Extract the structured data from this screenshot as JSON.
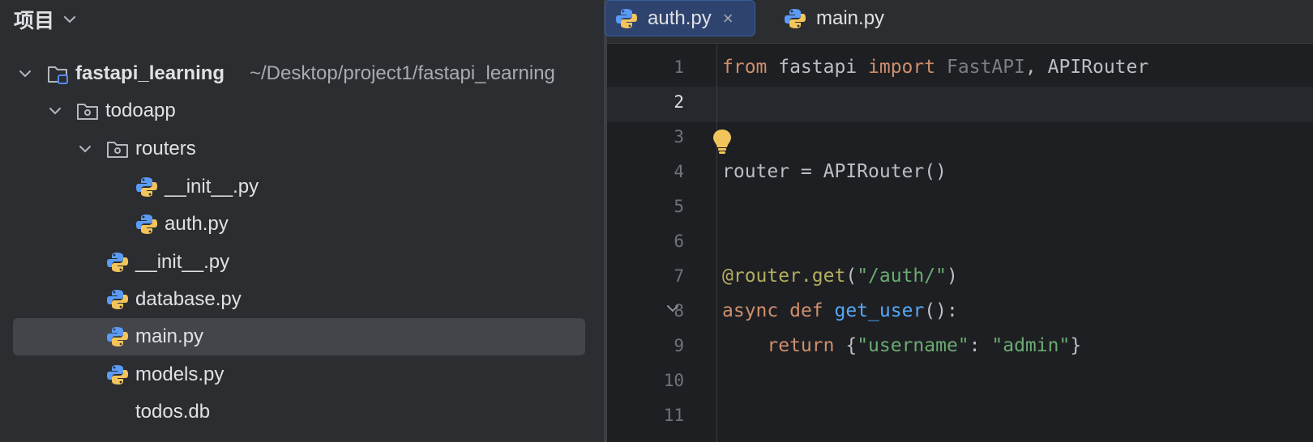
{
  "panel": {
    "title": "项目",
    "tree": [
      {
        "label": "fastapi_learning",
        "path": "~/Desktop/project1/fastapi_learning",
        "kind": "project-root",
        "icon": "project-folder-icon",
        "expanded": true,
        "bold": true
      },
      {
        "label": "todoapp",
        "kind": "folder",
        "icon": "package-folder-icon",
        "expanded": true
      },
      {
        "label": "routers",
        "kind": "folder",
        "icon": "package-folder-icon",
        "expanded": true
      },
      {
        "label": "__init__.py",
        "kind": "file",
        "icon": "python-icon"
      },
      {
        "label": "auth.py",
        "kind": "file",
        "icon": "python-icon"
      },
      {
        "label": "__init__.py",
        "kind": "file",
        "icon": "python-icon"
      },
      {
        "label": "database.py",
        "kind": "file",
        "icon": "python-icon"
      },
      {
        "label": "main.py",
        "kind": "file",
        "icon": "python-icon",
        "selected": true
      },
      {
        "label": "models.py",
        "kind": "file",
        "icon": "python-icon"
      },
      {
        "label": "todos.db",
        "kind": "file",
        "icon": "none"
      }
    ]
  },
  "editor": {
    "tabs": [
      {
        "label": "auth.py",
        "active": true,
        "closable": true,
        "close_glyph": "×"
      },
      {
        "label": "main.py",
        "active": false
      }
    ],
    "current_line": 2,
    "line_numbers": [
      "1",
      "2",
      "3",
      "4",
      "5",
      "6",
      "7",
      "8",
      "9",
      "10",
      "11"
    ],
    "code_lines": [
      [
        {
          "t": "from",
          "c": "kw"
        },
        {
          "t": " fastapi ",
          "c": "id"
        },
        {
          "t": "import",
          "c": "kw"
        },
        {
          "t": " ",
          "c": "id"
        },
        {
          "t": "FastAPI",
          "c": "dim"
        },
        {
          "t": ", APIRouter",
          "c": "id"
        }
      ],
      [],
      [],
      [
        {
          "t": "router = APIRouter()",
          "c": "id"
        }
      ],
      [],
      [],
      [
        {
          "t": "@router.get",
          "c": "dec"
        },
        {
          "t": "(",
          "c": "id"
        },
        {
          "t": "\"/auth/\"",
          "c": "str"
        },
        {
          "t": ")",
          "c": "id"
        }
      ],
      [
        {
          "t": "async",
          "c": "kw"
        },
        {
          "t": " ",
          "c": "id"
        },
        {
          "t": "def",
          "c": "kw"
        },
        {
          "t": " ",
          "c": "id"
        },
        {
          "t": "get_user",
          "c": "fn"
        },
        {
          "t": "():",
          "c": "id"
        }
      ],
      [
        {
          "t": "    ",
          "c": "id"
        },
        {
          "t": "return",
          "c": "kw"
        },
        {
          "t": " {",
          "c": "id"
        },
        {
          "t": "\"username\"",
          "c": "str"
        },
        {
          "t": ": ",
          "c": "id"
        },
        {
          "t": "\"admin\"",
          "c": "str"
        },
        {
          "t": "}",
          "c": "id"
        }
      ],
      [],
      []
    ],
    "icons": {
      "intention": "lightbulb-icon",
      "fold": "fold-chevron-icon"
    }
  },
  "colors": {
    "panel_bg": "#2b2d30",
    "editor_bg": "#1e1f22",
    "selection": "#43454a",
    "active_tab": "#2e436e",
    "keyword": "#cf8e6d",
    "string": "#6aab73",
    "function": "#56a8f5",
    "decorator": "#b3ae60"
  }
}
